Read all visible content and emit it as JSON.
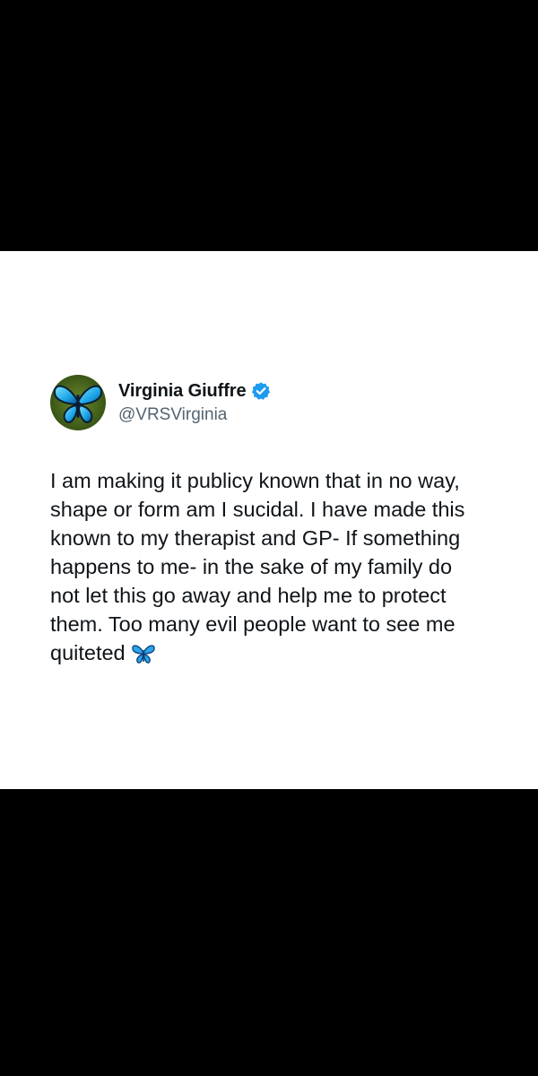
{
  "tweet": {
    "display_name": "Virginia Giuffre",
    "handle": "@VRSVirginia",
    "body": "I am making it publicy known that in no way,\nshape or form am I sucidal. I have made this\nknown to my therapist and GP- If something\nhappens to me- in the sake of my family do\nnot let this go away and help me to protect\nthem. Too many evil people want to see me\nquiteted",
    "avatar_icon": "blue-butterfly-icon",
    "verified_icon": "verified-badge-icon",
    "emoji_icon": "butterfly-emoji-icon"
  },
  "colors": {
    "background_bars": "#000000",
    "card": "#ffffff",
    "name": "#0f1419",
    "handle": "#536471",
    "verified_blue": "#1d9bf0",
    "butterfly_blue": "#2aa5e8"
  }
}
